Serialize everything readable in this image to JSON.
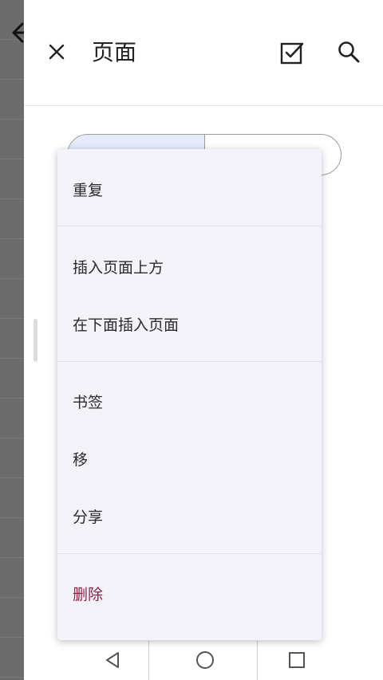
{
  "toolbar": {
    "title": "页面"
  },
  "menu": {
    "items": [
      {
        "label": "重复"
      },
      {
        "label": "插入页面上方"
      },
      {
        "label": "在下面插入页面"
      },
      {
        "label": "书签"
      },
      {
        "label": "移"
      },
      {
        "label": "分享"
      },
      {
        "label": "删除"
      }
    ]
  },
  "colors": {
    "accent_segment": "#e4ebfc",
    "danger": "#8c2444",
    "menu_background": "#f4f3f9"
  },
  "icons": {
    "toolbar": [
      "close-icon",
      "checkbox-icon",
      "search-icon"
    ],
    "navbar": [
      "back-triangle-icon",
      "home-circle-icon",
      "recents-square-icon"
    ]
  }
}
